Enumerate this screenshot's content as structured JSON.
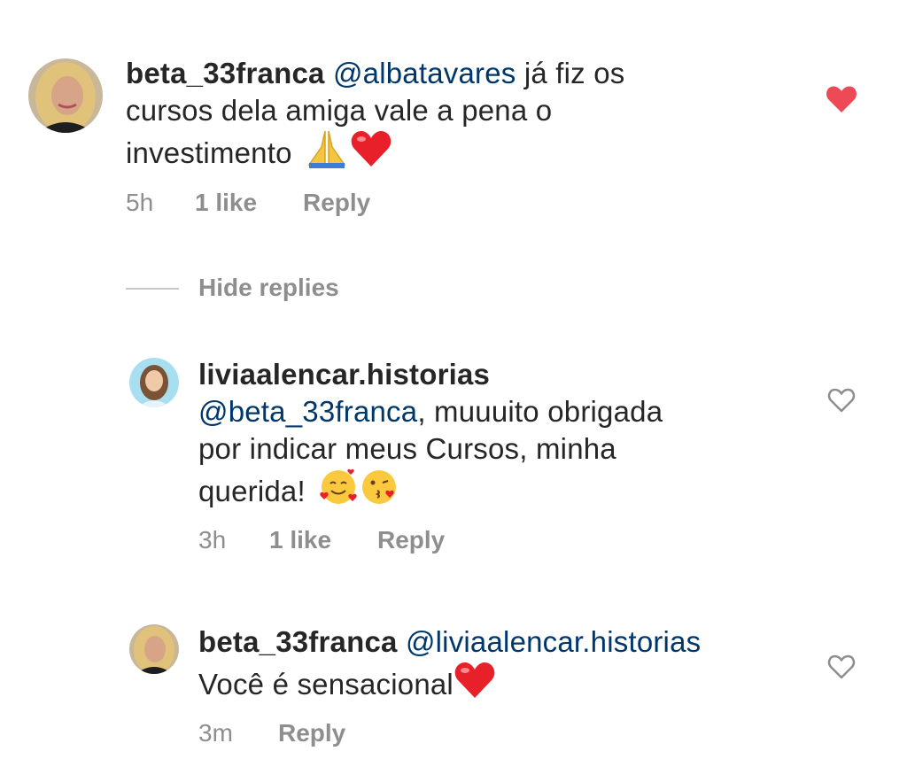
{
  "comments": [
    {
      "username": "beta_33franca",
      "mention": "@albatavares",
      "text_line1": "já fiz os",
      "text_line2": "cursos dela amiga vale a pena o",
      "text_line3": "investimento",
      "emojis": [
        "folded-hands-icon",
        "red-heart-icon"
      ],
      "time": "5h",
      "likes": "1 like",
      "reply_label": "Reply",
      "liked": true
    },
    {
      "username": "liviaalencar.historias",
      "mention": "@beta_33franca",
      "text_line1": ", muuuito obrigada",
      "text_line2": "por indicar meus Cursos, minha",
      "text_line3": "querida!",
      "emojis": [
        "smiling-face-with-hearts-icon",
        "face-blowing-kiss-icon"
      ],
      "time": "3h",
      "likes": "1 like",
      "reply_label": "Reply",
      "liked": false
    },
    {
      "username": "beta_33franca",
      "mention": "@liviaalencar.historias",
      "text_line2": "Você é sensacional",
      "emojis": [
        "red-heart-icon"
      ],
      "time": "3m",
      "reply_label": "Reply",
      "liked": false
    }
  ],
  "hide_replies_label": "Hide replies",
  "colors": {
    "mention": "#00376b",
    "meta": "#8e8e8e",
    "liked_heart": "#ed4956"
  }
}
